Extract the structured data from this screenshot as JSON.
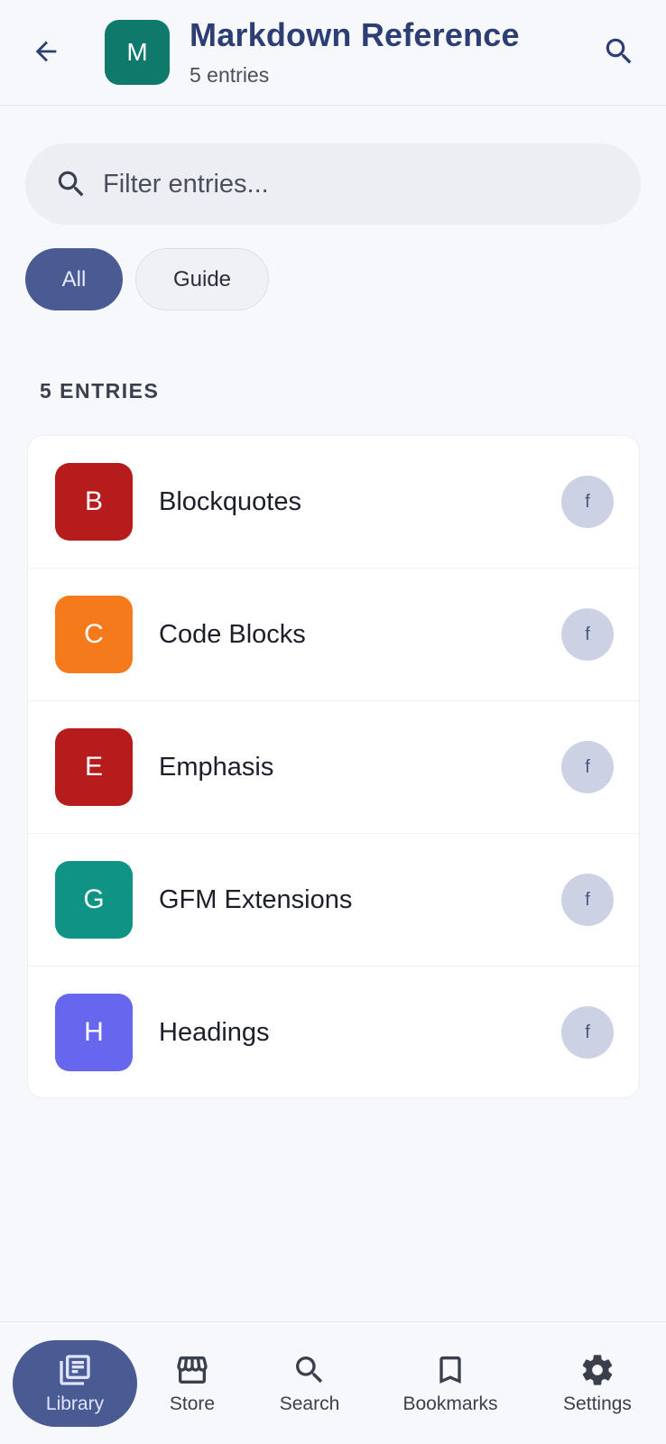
{
  "header": {
    "back_icon": "arrow-left-icon",
    "avatar_letter": "M",
    "avatar_color": "#0f7a6b",
    "title": "Markdown Reference",
    "subtitle": "5 entries",
    "search_icon": "search-icon"
  },
  "filter": {
    "placeholder": "Filter entries...",
    "value": ""
  },
  "chips": {
    "all": "All",
    "guide": "Guide",
    "selected": "All"
  },
  "section_label": "5 ENTRIES",
  "entries": [
    {
      "letter": "B",
      "label": "Blockquotes",
      "color": "#b71c1c",
      "action": "f"
    },
    {
      "letter": "C",
      "label": "Code Blocks",
      "color": "#f57a1c",
      "action": "f"
    },
    {
      "letter": "E",
      "label": "Emphasis",
      "color": "#b71c1c",
      "action": "f"
    },
    {
      "letter": "G",
      "label": "GFM Extensions",
      "color": "#0f9384",
      "action": "f"
    },
    {
      "letter": "H",
      "label": "Headings",
      "color": "#6667ee",
      "action": "f"
    }
  ],
  "nav": {
    "active": "Library",
    "items": [
      {
        "label": "Library",
        "icon": "library-icon"
      },
      {
        "label": "Store",
        "icon": "store-icon"
      },
      {
        "label": "Search",
        "icon": "search-icon"
      },
      {
        "label": "Bookmarks",
        "icon": "bookmark-icon"
      },
      {
        "label": "Settings",
        "icon": "gear-icon"
      }
    ]
  },
  "colors": {
    "primary": "#2c3e74",
    "active_chip": "#4a5a93",
    "background": "#f6f8fc"
  }
}
